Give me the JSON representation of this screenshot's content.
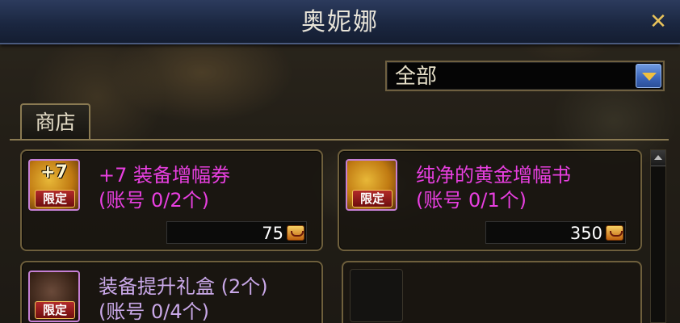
{
  "window": {
    "title": "奥妮娜",
    "close_label": "✕"
  },
  "filter": {
    "selected": "全部"
  },
  "tabs": [
    {
      "label": "商店"
    }
  ],
  "items": [
    {
      "name": "+7 装备增幅券",
      "limit": "(账号 0/2个)",
      "price": "75",
      "icon_text": "+7",
      "badge": "限定",
      "name_color": "#e83fe0"
    },
    {
      "name": "纯净的黄金增幅书",
      "limit": "(账号 0/1个)",
      "price": "350",
      "icon_text": "",
      "badge": "限定",
      "name_color": "#e83fe0"
    },
    {
      "name": "装备提升礼盒 (2个)",
      "limit": "(账号 0/4个)",
      "icon_text": "",
      "badge": "限定",
      "name_color": "#c9a8e8"
    }
  ],
  "icons": {
    "close": "close-icon",
    "dropdown": "chevron-down-icon",
    "currency": "currency-icon",
    "scroll_up": "scroll-up-icon"
  }
}
